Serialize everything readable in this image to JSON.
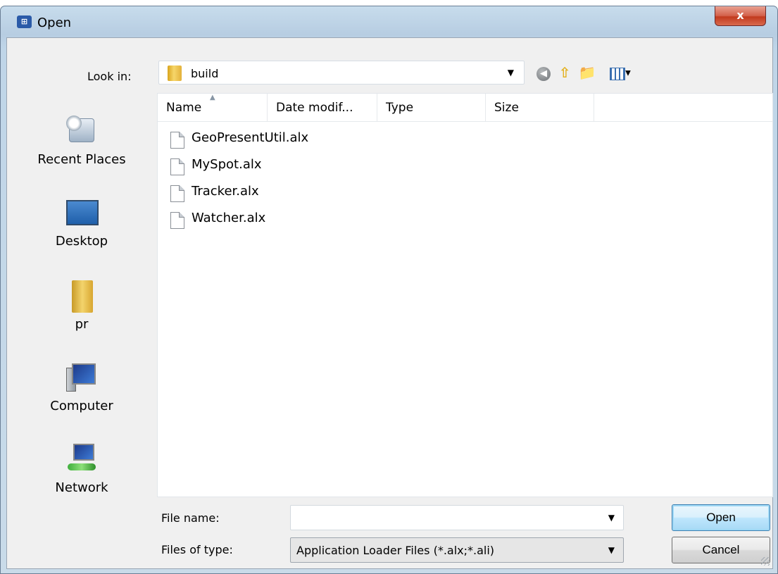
{
  "window": {
    "title": "Open",
    "app_icon": "application-icon",
    "close_glyph": "x"
  },
  "toolbar": {
    "look_in_label": "Look in:",
    "look_in_value": "build",
    "back_icon": "back-arrow-icon",
    "up_icon": "up-folder-icon",
    "new_folder_icon": "new-folder-icon",
    "view_icon": "view-menu-icon"
  },
  "places": [
    {
      "label": "Recent Places",
      "icon": "recent-places-icon"
    },
    {
      "label": "Desktop",
      "icon": "desktop-icon"
    },
    {
      "label": "pr",
      "icon": "user-folder-icon"
    },
    {
      "label": "Computer",
      "icon": "computer-icon"
    },
    {
      "label": "Network",
      "icon": "network-icon"
    }
  ],
  "file_list": {
    "columns": [
      "Name",
      "Date modif...",
      "Type",
      "Size"
    ],
    "sorted_by": "Name",
    "files": [
      "GeoPresentUtil.alx",
      "MySpot.alx",
      "Tracker.alx",
      "Watcher.alx"
    ]
  },
  "form": {
    "file_name_label": "File name:",
    "file_name_value": "",
    "file_type_label": "Files of type:",
    "file_type_value": "Application Loader Files (*.alx;*.ali)"
  },
  "buttons": {
    "open": "Open",
    "cancel": "Cancel"
  }
}
